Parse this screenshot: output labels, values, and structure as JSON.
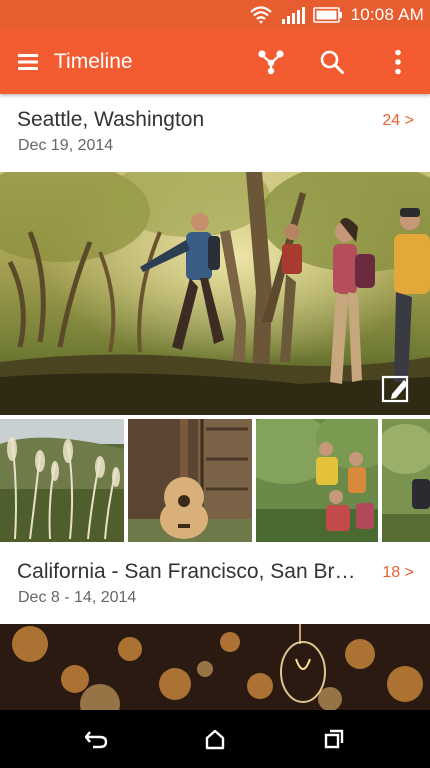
{
  "status_bar": {
    "time": "10:08 AM"
  },
  "app_bar": {
    "title": "Timeline",
    "icons": [
      "menu-icon",
      "share-icon",
      "search-icon",
      "more-vert-icon"
    ]
  },
  "events": [
    {
      "title": "Seattle, Washington",
      "date": "Dec 19, 2014",
      "count": "24 >"
    },
    {
      "title": "California - San Francisco, San Brun...",
      "date": "Dec 8 - 14, 2014",
      "count": "18 >"
    }
  ],
  "nav_bar": {
    "icons": [
      "back-icon",
      "home-icon",
      "recents-icon"
    ]
  },
  "colors": {
    "accent": "#f25c30",
    "status_bar": "#e85d2f",
    "count_text": "#e8612f"
  }
}
